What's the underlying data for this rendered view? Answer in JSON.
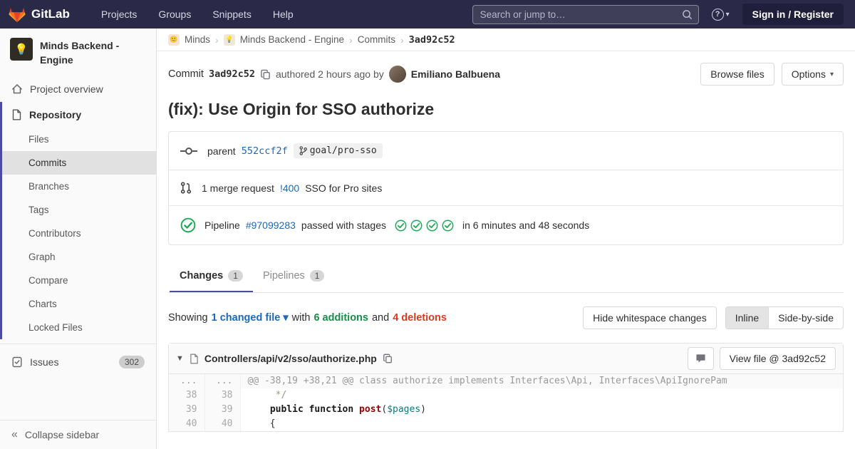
{
  "colors": {
    "header_bg": "#2a2a48",
    "accent_indigo": "#4b4ba3",
    "link_blue": "#1b69b6",
    "success_green": "#1aaa55",
    "danger_red": "#db3b21"
  },
  "header": {
    "brand": "GitLab",
    "nav": [
      "Projects",
      "Groups",
      "Snippets",
      "Help"
    ],
    "search_placeholder": "Search or jump to…",
    "signin_label": "Sign in / Register"
  },
  "sidebar": {
    "project_title": "Minds Backend - Engine",
    "project_overview": "Project overview",
    "repository": "Repository",
    "repo_items": [
      {
        "label": "Files",
        "active": false
      },
      {
        "label": "Commits",
        "active": true
      },
      {
        "label": "Branches",
        "active": false
      },
      {
        "label": "Tags",
        "active": false
      },
      {
        "label": "Contributors",
        "active": false
      },
      {
        "label": "Graph",
        "active": false
      },
      {
        "label": "Compare",
        "active": false
      },
      {
        "label": "Charts",
        "active": false
      },
      {
        "label": "Locked Files",
        "active": false
      }
    ],
    "issues_label": "Issues",
    "issues_count": "302",
    "collapse_label": "Collapse sidebar"
  },
  "breadcrumb": {
    "group": "Minds",
    "project": "Minds Backend - Engine",
    "section": "Commits",
    "sha": "3ad92c52"
  },
  "commit": {
    "label": "Commit",
    "sha": "3ad92c52",
    "authored": "authored 2 hours ago by",
    "author": "Emiliano Balbuena",
    "browse_files": "Browse files",
    "options": "Options",
    "title": "(fix): Use Origin for SSO authorize",
    "parent_label": "parent",
    "parent_sha": "552ccf2f",
    "branch": "goal/pro-sso",
    "mr_text": "1 merge request",
    "mr_ref": "!400",
    "mr_title": "SSO for Pro sites",
    "pipeline_label": "Pipeline",
    "pipeline_id": "#97099283",
    "pipeline_status": "passed with stages",
    "stages": 4,
    "pipeline_time": "in 6 minutes and 48 seconds"
  },
  "tabs": {
    "changes": {
      "label": "Changes",
      "count": "1"
    },
    "pipelines": {
      "label": "Pipelines",
      "count": "1"
    }
  },
  "diffbar": {
    "showing": "Showing",
    "changed_file": "1 changed file",
    "with_word": "with",
    "additions": "6 additions",
    "and_word": "and",
    "deletions": "4 deletions",
    "hide_whitespace": "Hide whitespace changes",
    "inline": "Inline",
    "side_by_side": "Side-by-side"
  },
  "file": {
    "path": "Controllers/api/v2/sso/authorize.php",
    "view_file": "View file @ 3ad92c52"
  },
  "diff": {
    "rows": [
      {
        "old": "...",
        "new": "...",
        "hunk": true,
        "segs": [
          {
            "t": "@@ -38,19 +38,21 @@ class authorize implements Interfaces\\Api, Interfaces\\ApiIgnorePam"
          }
        ]
      },
      {
        "old": "38",
        "new": "38",
        "segs": [
          {
            "t": "     */",
            "c": "cm"
          }
        ]
      },
      {
        "old": "39",
        "new": "39",
        "segs": [
          {
            "t": "    "
          },
          {
            "t": "public function",
            "c": "k"
          },
          {
            "t": " "
          },
          {
            "t": "post",
            "c": "nf"
          },
          {
            "t": "("
          },
          {
            "t": "$pages",
            "c": "nv"
          },
          {
            "t": ")"
          }
        ]
      },
      {
        "old": "40",
        "new": "40",
        "segs": [
          {
            "t": "    {"
          }
        ]
      }
    ]
  }
}
